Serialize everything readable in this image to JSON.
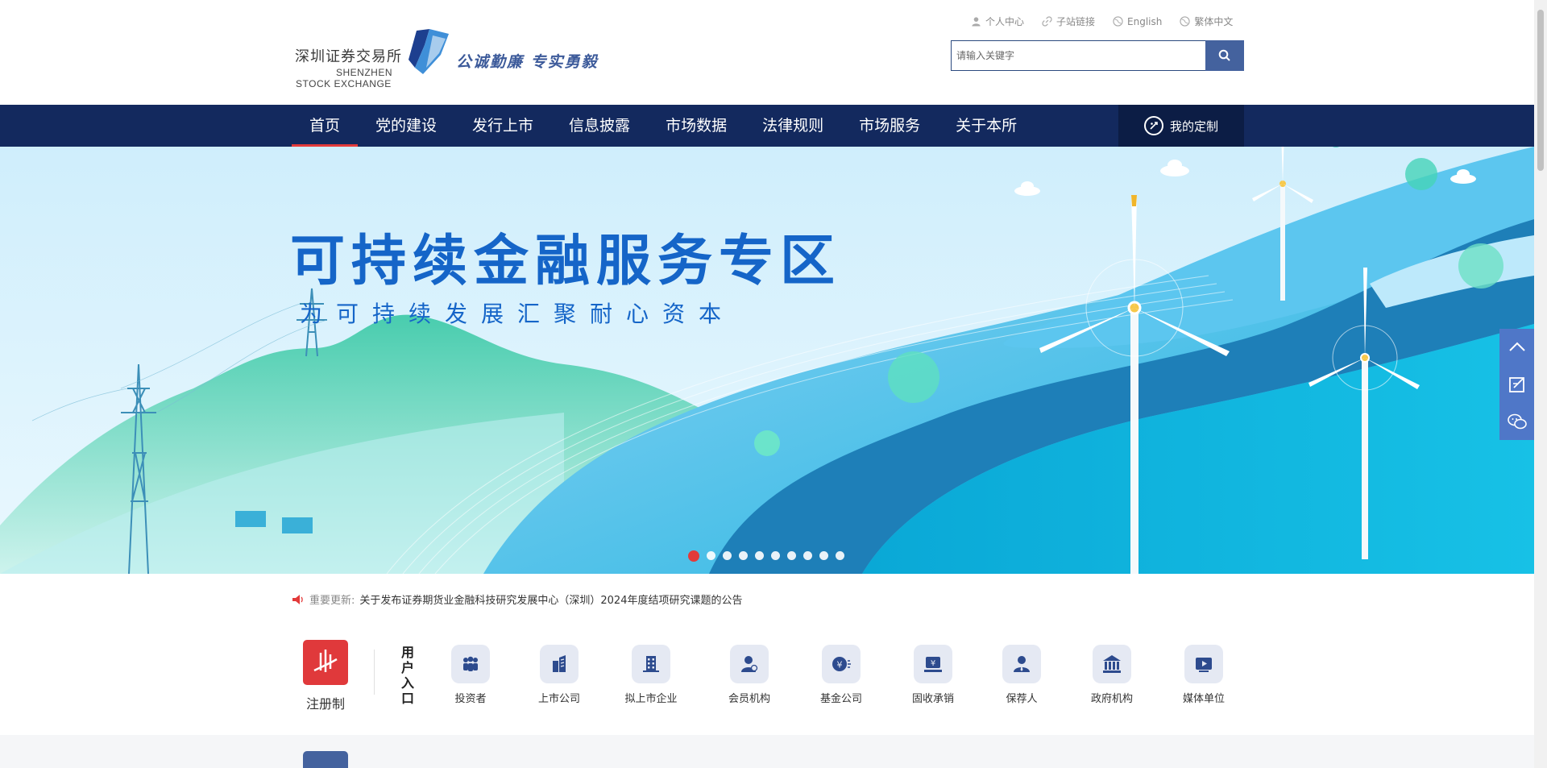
{
  "header": {
    "logo_cn": "深圳证券交易所",
    "logo_en_line1": "SHENZHEN",
    "logo_en_line2": "STOCK EXCHANGE",
    "slogan": "公诚勤廉  专实勇毅",
    "top_links": [
      {
        "label": "个人中心",
        "icon": "user-icon"
      },
      {
        "label": "子站链接",
        "icon": "link-icon"
      },
      {
        "label": "English",
        "icon": "globe-icon"
      },
      {
        "label": "繁体中文",
        "icon": "globe-icon"
      }
    ],
    "search": {
      "placeholder": "请输入关键字",
      "value": "",
      "button_icon": "search-icon"
    }
  },
  "nav": {
    "items": [
      {
        "label": "首页",
        "active": true
      },
      {
        "label": "党的建设",
        "active": false
      },
      {
        "label": "发行上市",
        "active": false
      },
      {
        "label": "信息披露",
        "active": false
      },
      {
        "label": "市场数据",
        "active": false
      },
      {
        "label": "法律规则",
        "active": false
      },
      {
        "label": "市场服务",
        "active": false
      },
      {
        "label": "关于本所",
        "active": false
      }
    ],
    "custom_label": "我的定制"
  },
  "banner": {
    "title": "可持续金融服务专区",
    "subtitle": "为可持续发展汇聚耐心资本",
    "slide_count": 10,
    "active_slide": 1
  },
  "notice": {
    "label": "重要更新:",
    "text": "关于发布证券期货业金融科技研究发展中心（深圳）2024年度结项研究课题的公告"
  },
  "user_entry": {
    "registration_label": "注册制",
    "title": "用户入口",
    "items": [
      {
        "label": "投资者",
        "icon": "investors-icon"
      },
      {
        "label": "上市公司",
        "icon": "listed-company-icon"
      },
      {
        "label": "拟上市企业",
        "icon": "building-icon"
      },
      {
        "label": "会员机构",
        "icon": "member-icon"
      },
      {
        "label": "基金公司",
        "icon": "fund-icon"
      },
      {
        "label": "固收承销",
        "icon": "fixed-income-icon"
      },
      {
        "label": "保荐人",
        "icon": "sponsor-icon"
      },
      {
        "label": "政府机构",
        "icon": "government-icon"
      },
      {
        "label": "媒体单位",
        "icon": "media-icon"
      }
    ]
  },
  "side_tools": [
    "back-to-top-icon",
    "feedback-icon",
    "wechat-icon"
  ],
  "colors": {
    "nav_bg": "#13295e",
    "accent_red": "#e33a3a",
    "brand_blue": "#1565c8",
    "side_blue": "#4f77c8"
  }
}
